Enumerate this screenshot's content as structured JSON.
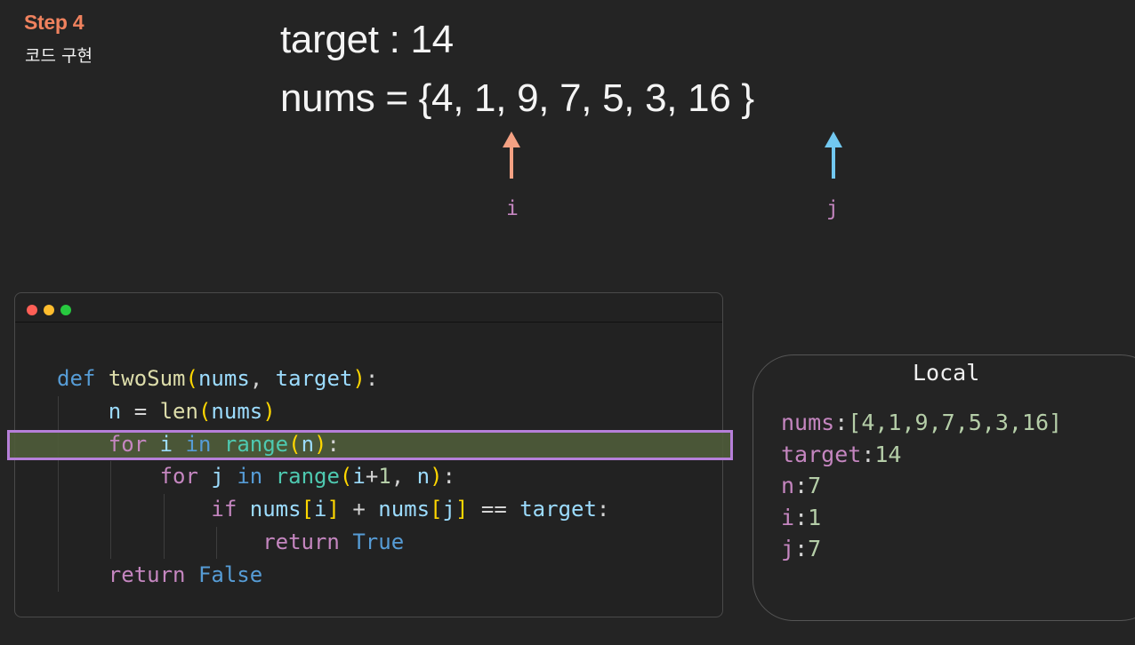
{
  "step": {
    "title": "Step 4",
    "subtitle": "코드 구현"
  },
  "problem": {
    "target_line": "target : 14",
    "nums_line": "nums = {4, 1, 9, 7, 5, 3, 16 }"
  },
  "pointers": {
    "i": {
      "label": "i",
      "color": "#f4a183"
    },
    "j": {
      "label": "j",
      "color": "#72c8f0"
    }
  },
  "code_window": {
    "lines": [
      [
        {
          "t": "def",
          "c": "kw"
        },
        {
          "t": " ",
          "c": "txt"
        },
        {
          "t": "twoSum",
          "c": "fn"
        },
        {
          "t": "(",
          "c": "par"
        },
        {
          "t": "nums",
          "c": "var"
        },
        {
          "t": ", ",
          "c": "txt"
        },
        {
          "t": "target",
          "c": "var"
        },
        {
          "t": ")",
          "c": "par"
        },
        {
          "t": ":",
          "c": "txt"
        }
      ],
      [
        {
          "t": "    ",
          "c": "txt"
        },
        {
          "t": "n",
          "c": "var"
        },
        {
          "t": " = ",
          "c": "txt"
        },
        {
          "t": "len",
          "c": "bi"
        },
        {
          "t": "(",
          "c": "par"
        },
        {
          "t": "nums",
          "c": "var"
        },
        {
          "t": ")",
          "c": "par"
        }
      ],
      [
        {
          "t": "    ",
          "c": "txt"
        },
        {
          "t": "for",
          "c": "ctl"
        },
        {
          "t": " ",
          "c": "txt"
        },
        {
          "t": "i",
          "c": "var"
        },
        {
          "t": " ",
          "c": "txt"
        },
        {
          "t": "in",
          "c": "kw"
        },
        {
          "t": " ",
          "c": "txt"
        },
        {
          "t": "range",
          "c": "cls"
        },
        {
          "t": "(",
          "c": "par"
        },
        {
          "t": "n",
          "c": "var"
        },
        {
          "t": ")",
          "c": "par"
        },
        {
          "t": ":",
          "c": "txt"
        }
      ],
      [
        {
          "t": "        ",
          "c": "txt"
        },
        {
          "t": "for",
          "c": "ctl"
        },
        {
          "t": " ",
          "c": "txt"
        },
        {
          "t": "j",
          "c": "var"
        },
        {
          "t": " ",
          "c": "txt"
        },
        {
          "t": "in",
          "c": "kw"
        },
        {
          "t": " ",
          "c": "txt"
        },
        {
          "t": "range",
          "c": "cls"
        },
        {
          "t": "(",
          "c": "par"
        },
        {
          "t": "i",
          "c": "var"
        },
        {
          "t": "+",
          "c": "txt"
        },
        {
          "t": "1",
          "c": "num"
        },
        {
          "t": ", ",
          "c": "txt"
        },
        {
          "t": "n",
          "c": "var"
        },
        {
          "t": ")",
          "c": "par"
        },
        {
          "t": ":",
          "c": "txt"
        }
      ],
      [
        {
          "t": "            ",
          "c": "txt"
        },
        {
          "t": "if",
          "c": "ctl"
        },
        {
          "t": " ",
          "c": "txt"
        },
        {
          "t": "nums",
          "c": "var"
        },
        {
          "t": "[",
          "c": "par"
        },
        {
          "t": "i",
          "c": "var"
        },
        {
          "t": "]",
          "c": "par"
        },
        {
          "t": " + ",
          "c": "txt"
        },
        {
          "t": "nums",
          "c": "var"
        },
        {
          "t": "[",
          "c": "par"
        },
        {
          "t": "j",
          "c": "var"
        },
        {
          "t": "]",
          "c": "par"
        },
        {
          "t": " == ",
          "c": "txt"
        },
        {
          "t": "target",
          "c": "var"
        },
        {
          "t": ":",
          "c": "txt"
        }
      ],
      [
        {
          "t": "                ",
          "c": "txt"
        },
        {
          "t": "return",
          "c": "ctl"
        },
        {
          "t": " ",
          "c": "txt"
        },
        {
          "t": "True",
          "c": "kw"
        }
      ],
      [
        {
          "t": "    ",
          "c": "txt"
        },
        {
          "t": "return",
          "c": "ctl"
        },
        {
          "t": " ",
          "c": "txt"
        },
        {
          "t": "False",
          "c": "kw"
        }
      ]
    ],
    "highlighted_line": 3
  },
  "locals": {
    "title": "Local",
    "vars": [
      {
        "name": "nums",
        "value": "[4,1,9,7,5,3,16]"
      },
      {
        "name": "target",
        "value": "14"
      },
      {
        "name": "n",
        "value": "7"
      },
      {
        "name": "i",
        "value": "1"
      },
      {
        "name": "j",
        "value": "7"
      }
    ]
  }
}
